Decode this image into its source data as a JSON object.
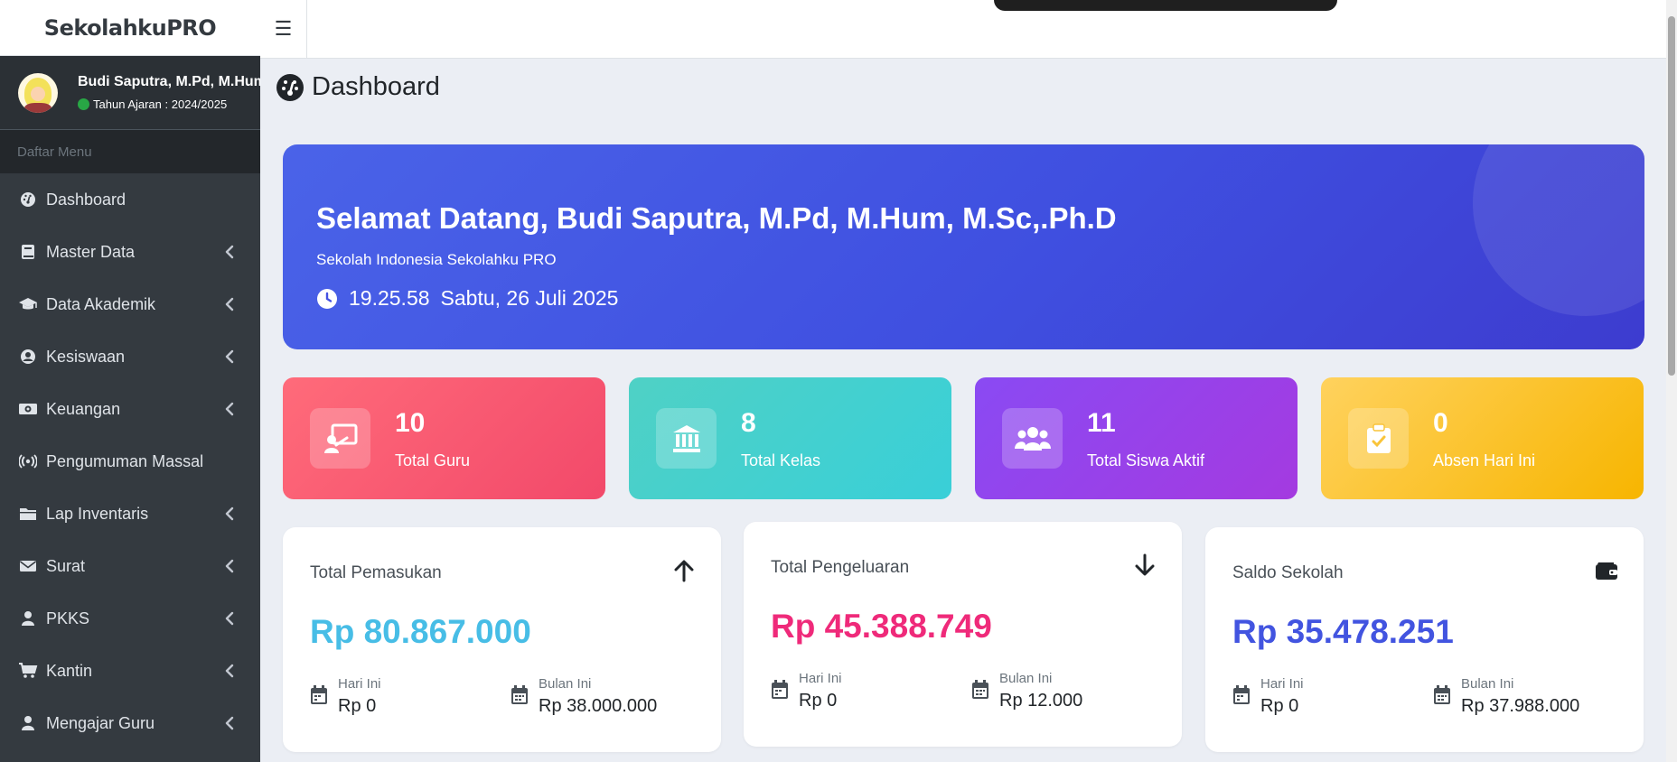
{
  "brand": {
    "name": "SekolahkuPRO"
  },
  "user": {
    "name": "Budi Saputra, M.Pd, M.Hum, M.Sc,.Ph.D",
    "year_label": "Tahun Ajaran : 2024/2025"
  },
  "sidebar": {
    "header": "Daftar Menu",
    "items": [
      {
        "label": "Dashboard",
        "icon": "tachometer-icon",
        "has_chevron": false
      },
      {
        "label": "Master Data",
        "icon": "book-icon",
        "has_chevron": true
      },
      {
        "label": "Data Akademik",
        "icon": "graduation-cap-icon",
        "has_chevron": true
      },
      {
        "label": "Kesiswaan",
        "icon": "user-circle-icon",
        "has_chevron": true
      },
      {
        "label": "Keuangan",
        "icon": "money-icon",
        "has_chevron": true
      },
      {
        "label": "Pengumuman Massal",
        "icon": "broadcast-icon",
        "has_chevron": false
      },
      {
        "label": "Lap Inventaris",
        "icon": "folder-icon",
        "has_chevron": true
      },
      {
        "label": "Surat",
        "icon": "envelope-icon",
        "has_chevron": true
      },
      {
        "label": "PKKS",
        "icon": "user-icon",
        "has_chevron": true
      },
      {
        "label": "Kantin",
        "icon": "cart-icon",
        "has_chevron": true
      },
      {
        "label": "Mengajar Guru",
        "icon": "user-icon",
        "has_chevron": true
      }
    ]
  },
  "topbar": {
    "menu_icon": "☰"
  },
  "page": {
    "title": "Dashboard"
  },
  "hero": {
    "greeting": "Selamat Datang, Budi Saputra, M.Pd, M.Hum, M.Sc,.Ph.D",
    "school": "Sekolah Indonesia Sekolahku PRO",
    "time": "19.25.58",
    "date": "Sabtu, 26 Juli 2025"
  },
  "stats": [
    {
      "value": "10",
      "label": "Total Guru",
      "icon": "teacher-icon"
    },
    {
      "value": "8",
      "label": "Total Kelas",
      "icon": "school-building-icon"
    },
    {
      "value": "11",
      "label": "Total Siswa Aktif",
      "icon": "users-icon"
    },
    {
      "value": "0",
      "label": "Absen Hari Ini",
      "icon": "clipboard-check-icon"
    }
  ],
  "finance": [
    {
      "title": "Total Pemasukan",
      "value": "Rp 80.867.000",
      "color": "#47bde6",
      "icon": "arrow-up-icon",
      "today_label": "Hari Ini",
      "today_value": "Rp 0",
      "month_label": "Bulan Ini",
      "month_value": "Rp 38.000.000"
    },
    {
      "title": "Total Pengeluaran",
      "value": "Rp 45.388.749",
      "color": "#ef2a7a",
      "icon": "arrow-down-icon",
      "today_label": "Hari Ini",
      "today_value": "Rp 0",
      "month_label": "Bulan Ini",
      "month_value": "Rp 12.000"
    },
    {
      "title": "Saldo Sekolah",
      "value": "Rp 35.478.251",
      "color": "#4254e0",
      "icon": "wallet-icon",
      "today_label": "Hari Ini",
      "today_value": "Rp 0",
      "month_label": "Bulan Ini",
      "month_value": "Rp 37.988.000"
    }
  ]
}
